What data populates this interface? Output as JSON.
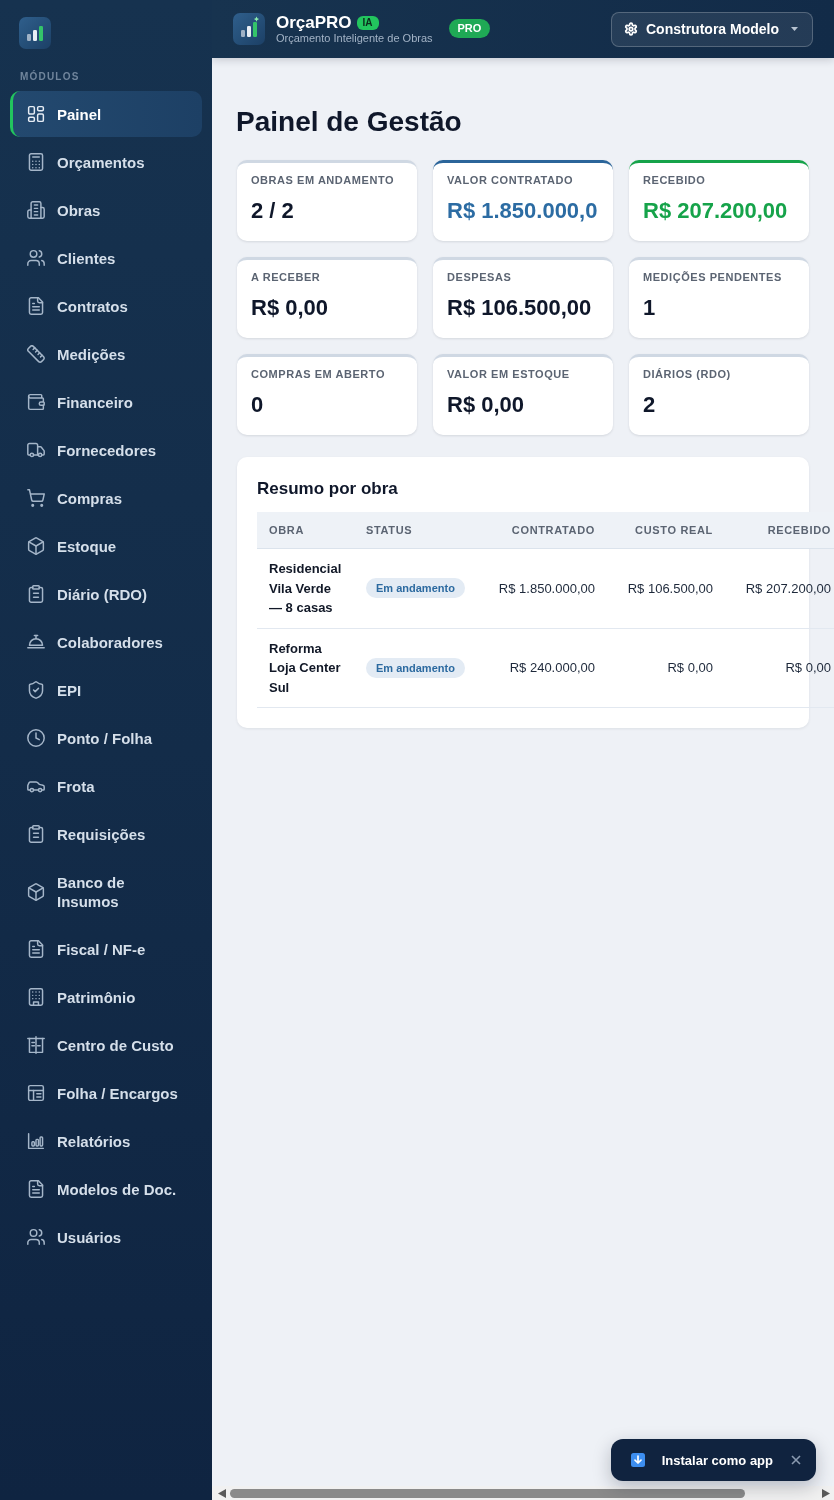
{
  "sidebar": {
    "section_title": "MÓDULOS",
    "items": [
      {
        "label": "Painel",
        "selected": true
      },
      {
        "label": "Orçamentos",
        "selected": false
      },
      {
        "label": "Obras",
        "selected": false
      },
      {
        "label": "Clientes",
        "selected": false
      },
      {
        "label": "Contratos",
        "selected": false
      },
      {
        "label": "Medições",
        "selected": false
      },
      {
        "label": "Financeiro",
        "selected": false
      },
      {
        "label": "Fornecedores",
        "selected": false
      },
      {
        "label": "Compras",
        "selected": false
      },
      {
        "label": "Estoque",
        "selected": false
      },
      {
        "label": "Diário (RDO)",
        "selected": false
      },
      {
        "label": "Colaboradores",
        "selected": false
      },
      {
        "label": "EPI",
        "selected": false
      },
      {
        "label": "Ponto / Folha",
        "selected": false
      },
      {
        "label": "Frota",
        "selected": false
      },
      {
        "label": "Requisições",
        "selected": false
      },
      {
        "label": "Banco de Insumos",
        "selected": false
      },
      {
        "label": "Fiscal / NF-e",
        "selected": false
      },
      {
        "label": "Patrimônio",
        "selected": false
      },
      {
        "label": "Centro de Custo",
        "selected": false
      },
      {
        "label": "Folha / Encargos",
        "selected": false
      },
      {
        "label": "Relatórios",
        "selected": false
      },
      {
        "label": "Modelos de Doc.",
        "selected": false
      },
      {
        "label": "Usuários",
        "selected": false
      }
    ]
  },
  "header": {
    "brand": "OrçaPRO",
    "brand_badge": "IA",
    "tagline": "Orçamento Inteligente de Obras",
    "plan_badge": "PRO",
    "company": "Construtora Modelo"
  },
  "page_title": "Painel de Gestão",
  "stat_cards": [
    {
      "label": "OBRAS EM ANDAMENTO",
      "value": "2 / 2",
      "kind": "neutral"
    },
    {
      "label": "VALOR CONTRATADO",
      "value": "R$ 1.850.000,0",
      "kind": "primary"
    },
    {
      "label": "RECEBIDO",
      "value": "R$ 207.200,00",
      "kind": "success"
    },
    {
      "label": "A RECEBER",
      "value": "R$ 0,00",
      "kind": "neutral"
    },
    {
      "label": "DESPESAS",
      "value": "R$ 106.500,00",
      "kind": "neutral"
    },
    {
      "label": "MEDIÇÕES PENDENTES",
      "value": "1",
      "kind": "neutral"
    },
    {
      "label": "COMPRAS EM ABERTO",
      "value": "0",
      "kind": "neutral"
    },
    {
      "label": "VALOR EM ESTOQUE",
      "value": "R$ 0,00",
      "kind": "neutral"
    },
    {
      "label": "DIÁRIOS (RDO)",
      "value": "2",
      "kind": "neutral"
    }
  ],
  "summary": {
    "title": "Resumo por obra",
    "columns": [
      "OBRA",
      "STATUS",
      "CONTRATADO",
      "CUSTO REAL",
      "RECEBIDO"
    ],
    "rows": [
      {
        "obra": "Residencial Vila Verde — 8 casas",
        "status": "Em andamento",
        "contratado": "R$ 1.850.000,00",
        "custo_real": "R$ 106.500,00",
        "recebido": "R$ 207.200,00"
      },
      {
        "obra": "Reforma Loja Center Sul",
        "status": "Em andamento",
        "contratado": "R$ 240.000,00",
        "custo_real": "R$ 0,00",
        "recebido": "R$ 0,00"
      }
    ]
  },
  "install_prompt": {
    "label": "Instalar como app"
  }
}
